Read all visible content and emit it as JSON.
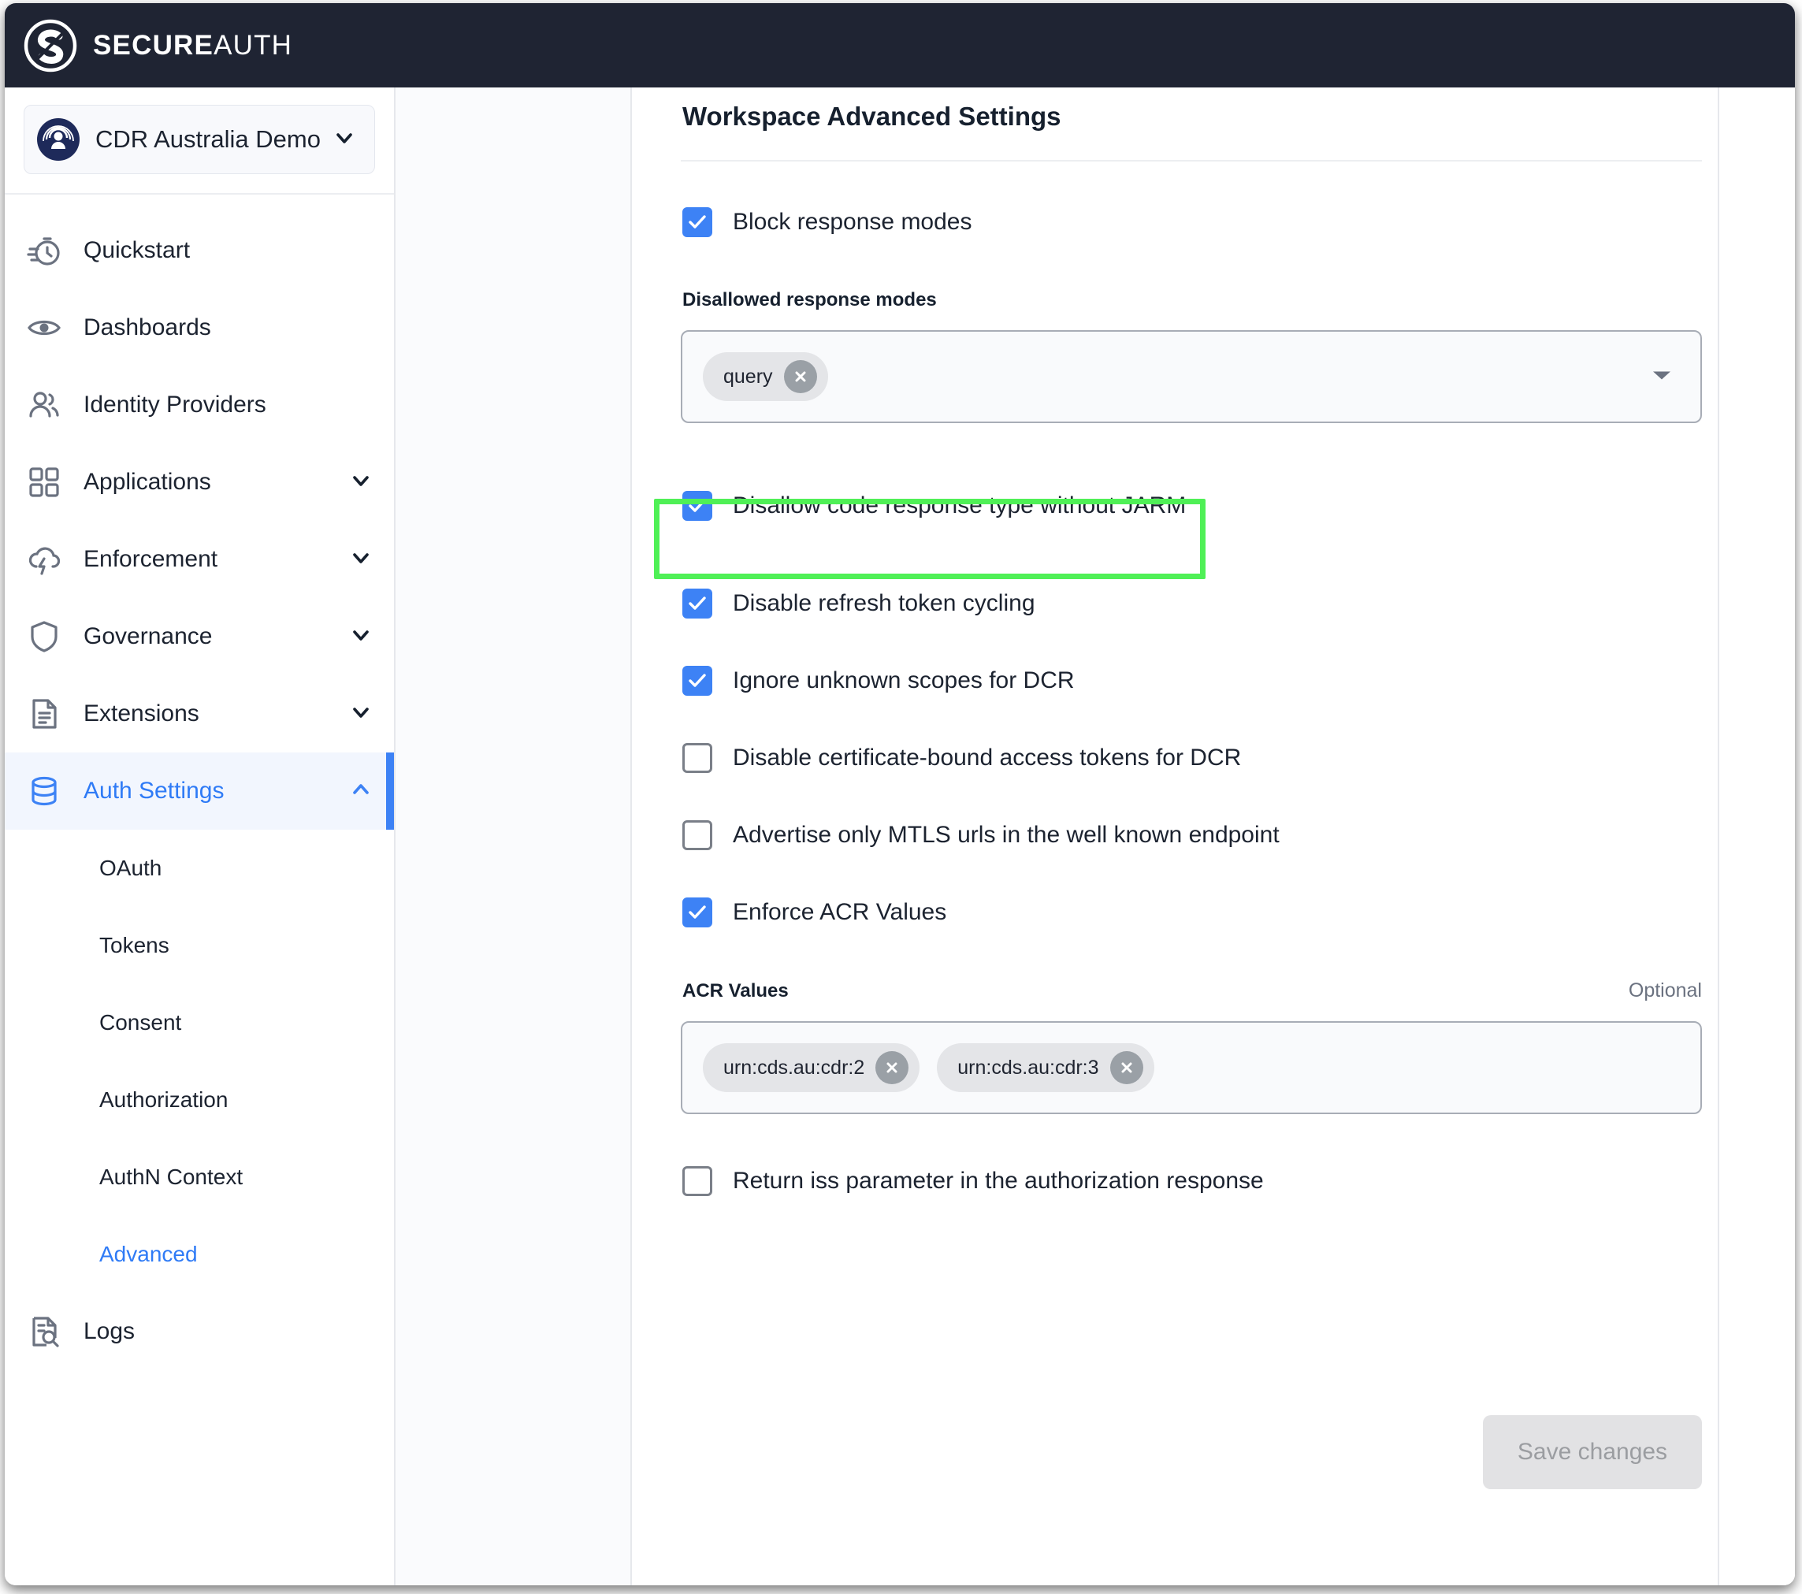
{
  "brand": {
    "name_bold": "SECURE",
    "name_light": "AUTH",
    "logo_icon": "secureauth-logo-icon"
  },
  "workspace": {
    "name": "CDR Australia Demo",
    "avatar_icon": "workspace-avatar-icon",
    "chevron_icon": "chevron-down-icon"
  },
  "sidebar": {
    "items": [
      {
        "label": "Quickstart",
        "icon": "stopwatch-icon",
        "expandable": false,
        "active": false
      },
      {
        "label": "Dashboards",
        "icon": "eye-icon",
        "expandable": false,
        "active": false
      },
      {
        "label": "Identity Providers",
        "icon": "users-icon",
        "expandable": false,
        "active": false
      },
      {
        "label": "Applications",
        "icon": "grid-icon",
        "expandable": true,
        "active": false
      },
      {
        "label": "Enforcement",
        "icon": "cloud-lightning-icon",
        "expandable": true,
        "active": false
      },
      {
        "label": "Governance",
        "icon": "shield-icon",
        "expandable": true,
        "active": false
      },
      {
        "label": "Extensions",
        "icon": "document-lines-icon",
        "expandable": true,
        "active": false
      },
      {
        "label": "Auth Settings",
        "icon": "database-icon",
        "expandable": true,
        "active": true
      }
    ],
    "sub_items": [
      {
        "label": "OAuth",
        "active": false
      },
      {
        "label": "Tokens",
        "active": false
      },
      {
        "label": "Consent",
        "active": false
      },
      {
        "label": "Authorization",
        "active": false
      },
      {
        "label": "AuthN Context",
        "active": false
      },
      {
        "label": "Advanced",
        "active": true
      }
    ],
    "footer_items": [
      {
        "label": "Logs",
        "icon": "log-search-icon",
        "active": false
      }
    ]
  },
  "main": {
    "title": "Workspace Advanced Settings",
    "checkbox_block_response_modes": {
      "label": "Block response modes",
      "checked": true
    },
    "disallowed_response_modes": {
      "label": "Disallowed response modes",
      "chips": [
        "query"
      ],
      "remove_icon": "close-circle-icon",
      "caret_icon": "caret-down-icon"
    },
    "checkbox_disallow_code_without_jarm": {
      "label": "Disallow code response type without JARM",
      "checked": true,
      "highlighted": true,
      "highlight_color": "#4ff056"
    },
    "checkbox_disable_refresh_token_cycling": {
      "label": "Disable refresh token cycling",
      "checked": true
    },
    "checkbox_ignore_unknown_scopes_dcr": {
      "label": "Ignore unknown scopes for DCR",
      "checked": true
    },
    "checkbox_disable_cert_bound_tokens_dcr": {
      "label": "Disable certificate-bound access tokens for DCR",
      "checked": false
    },
    "checkbox_advertise_mtls_urls": {
      "label": "Advertise only MTLS urls in the well known endpoint",
      "checked": false
    },
    "checkbox_enforce_acr_values": {
      "label": "Enforce ACR Values",
      "checked": true
    },
    "acr_values": {
      "label": "ACR Values",
      "optional_text": "Optional",
      "chips": [
        "urn:cds.au:cdr:2",
        "urn:cds.au:cdr:3"
      ],
      "remove_icon": "close-circle-icon"
    },
    "checkbox_return_iss_parameter": {
      "label": "Return iss parameter in the authorization response",
      "checked": false
    },
    "save_button": {
      "label": "Save changes",
      "disabled": true
    }
  },
  "colors": {
    "topbar": "#1f2433",
    "accent_blue": "#3d82f5",
    "link_blue": "#2f7bf6",
    "highlight_green": "#4ff056",
    "avatar_navy": "#1e2a5a"
  }
}
